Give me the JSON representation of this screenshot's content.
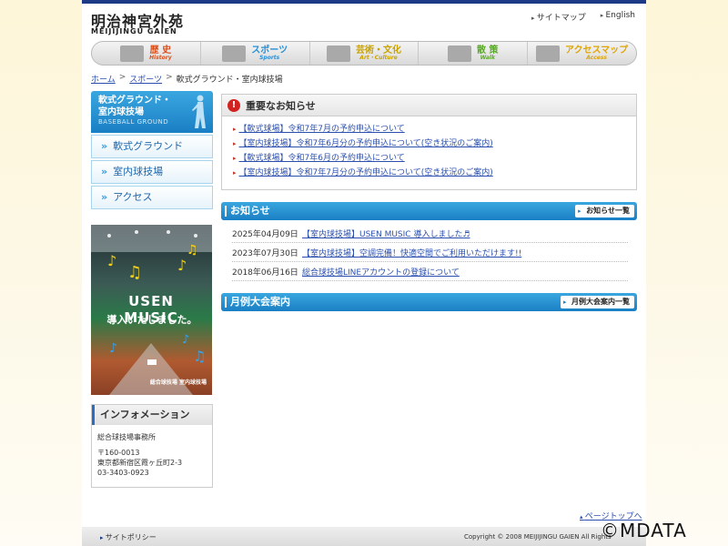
{
  "brand": {
    "name_jp": "明治神宮外苑",
    "name_en": "MEIJIJINGU GAIEN"
  },
  "top_links": [
    "サイトマップ",
    "English"
  ],
  "global_nav": [
    {
      "jp": "歴 史",
      "en": "History",
      "icon": "building-icon"
    },
    {
      "jp": "スポーツ",
      "en": "Sports",
      "icon": "stadium-icon"
    },
    {
      "jp": "芸術・文化",
      "en": "Art・Culture",
      "icon": "art-icon"
    },
    {
      "jp": "散 策",
      "en": "Walk",
      "icon": "ginkgo-icon"
    },
    {
      "jp": "アクセスマップ",
      "en": "Access",
      "icon": "bus-icon"
    }
  ],
  "breadcrumb": [
    "ホーム",
    "スポーツ",
    "軟式グラウンド・室内球技場"
  ],
  "sidebar": {
    "title_line1": "軟式グラウンド・",
    "title_line2": "室内球技場",
    "title_en": "BASEBALL GROUND",
    "items": [
      "軟式グラウンド",
      "室内球技場",
      "アクセス"
    ]
  },
  "banner": {
    "title": "USEN MUSIC",
    "subtitle": "導入いたしました。",
    "footer": "総合球技場 室内球技場"
  },
  "information": {
    "heading": "インフォメーション",
    "office": "総合球技場事務所",
    "postal": "〒160-0013",
    "address": "東京都新宿区霞ヶ丘町2-3",
    "phone": "03-3403-0923"
  },
  "important": {
    "heading": "重要なお知らせ",
    "items": [
      "【軟式球場】令和7年7月の予約申込について",
      "【室内球技場】令和7年6月分の予約申込について(空き状況のご案内)",
      "【軟式球場】令和7年6月の予約申込について",
      "【室内球技場】令和7年7月分の予約申込について(空き状況のご案内)"
    ]
  },
  "news": {
    "heading": "お知らせ",
    "button": "お知らせ一覧",
    "items": [
      {
        "date": "2025年04月09日",
        "title": "【室内球技場】USEN MUSIC 導入しました♬"
      },
      {
        "date": "2023年07月30日",
        "title": "【室内球技場】空調完備！快適空間でご利用いただけます!!"
      },
      {
        "date": "2018年06月16日",
        "title": "総合球技場LINEアカウントの登録について"
      }
    ]
  },
  "tournament": {
    "heading": "月例大会案内",
    "button": "月例大会案内一覧"
  },
  "page_top": "ページトップへ",
  "footer": {
    "policy": "サイトポリシー",
    "copyright": "Copyright © 2008 MEIJIJINGU GAIEN All Rights"
  },
  "watermark": "©MDATA",
  "colors": {
    "nav_blue": "#1a7fc4",
    "header_dark": "#1d3a86",
    "link": "#2a4fae",
    "alert": "#d32222"
  }
}
